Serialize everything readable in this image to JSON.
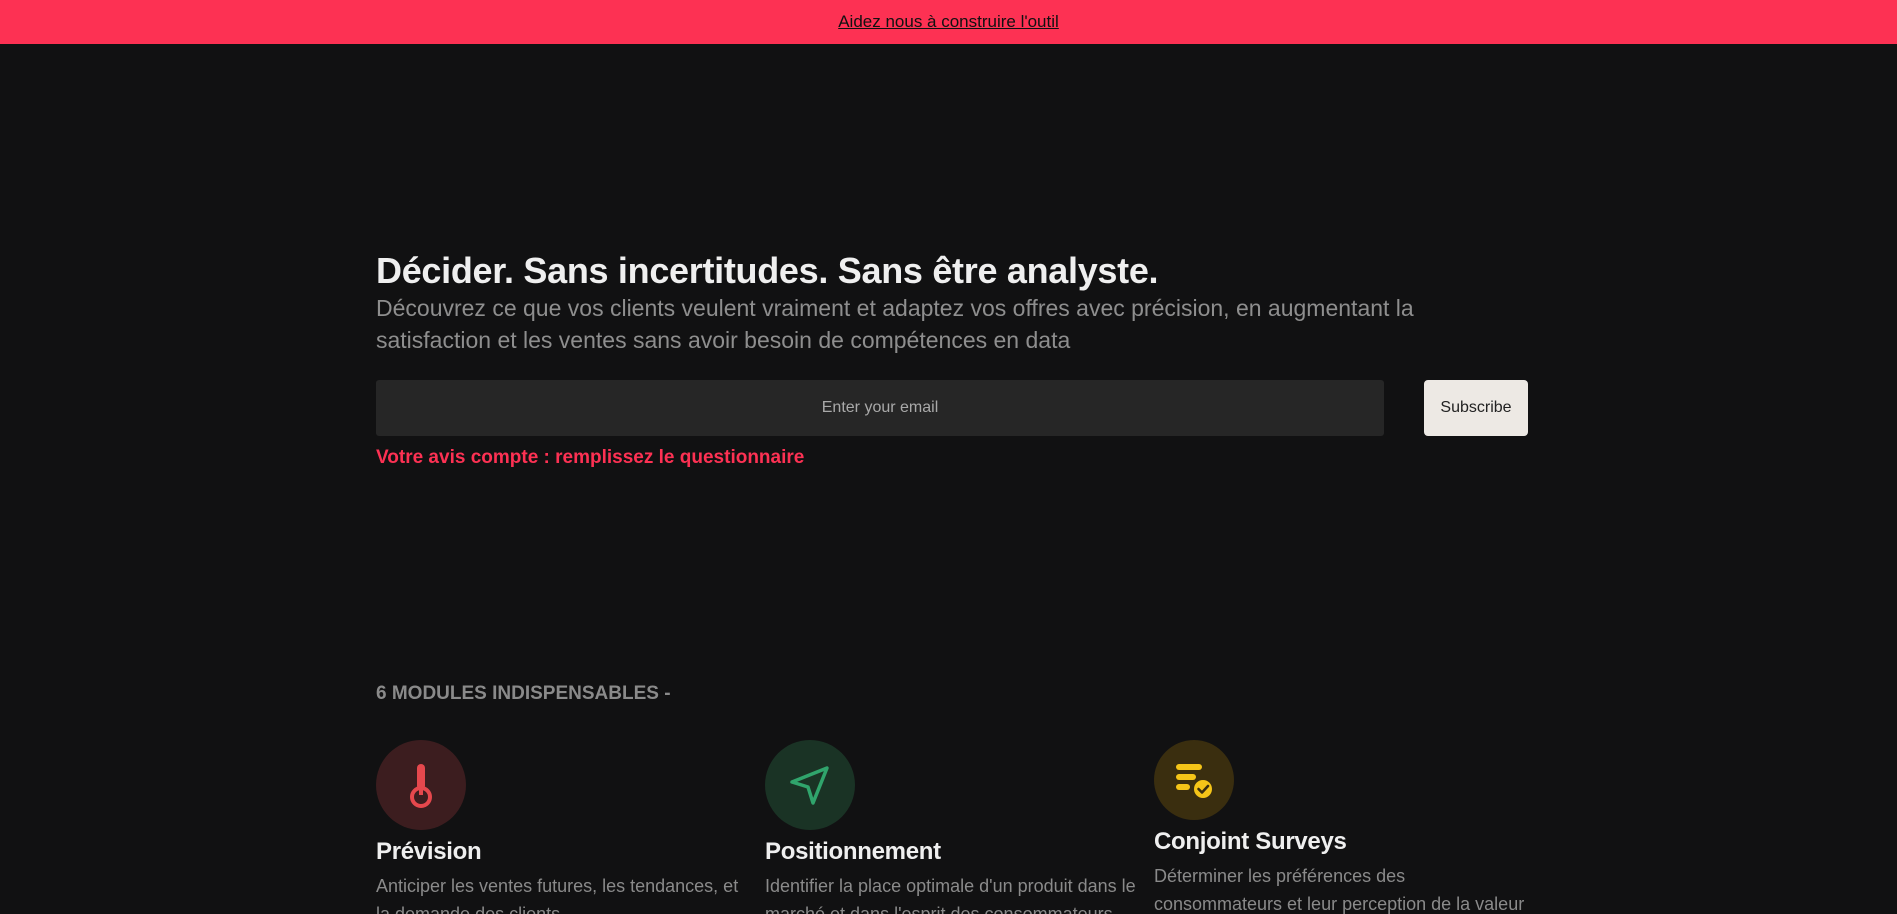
{
  "banner": {
    "link_label": "Aidez nous à construire l'outil",
    "color": "#fd3153"
  },
  "hero": {
    "title": "Décider. Sans incertitudes. Sans être analyste.",
    "subtitle": "Découvrez ce que vos clients veulent vraiment et adaptez vos offres avec précision, en augmentant la satisfaction et les ventes sans avoir besoin de compétences en data"
  },
  "subscribe": {
    "email_placeholder": "Enter your email",
    "email_value": "",
    "button_label": "Subscribe"
  },
  "survey_link": "Votre avis compte : remplissez le questionnaire",
  "modules": {
    "heading": "6 MODULES INDISPENSABLES -",
    "items": [
      {
        "title": "Prévision",
        "description": "Anticiper les ventes futures, les tendances, et la demande des clients",
        "icon": "thermometer-icon",
        "accent": "#e5484d",
        "bg": "#3c1d1f"
      },
      {
        "title": "Positionnement",
        "description": "Identifier la place optimale d'un produit dans le marché et dans l'esprit des consommateurs",
        "icon": "navigation-arrow-icon",
        "accent": "#30a46c",
        "bg": "#1a3325"
      },
      {
        "title": "Conjoint Surveys",
        "description": "Déterminer les préférences des consommateurs et leur perception de la valeur",
        "icon": "list-check-icon",
        "accent": "#f5c518",
        "bg": "#3a2e0f"
      }
    ]
  }
}
